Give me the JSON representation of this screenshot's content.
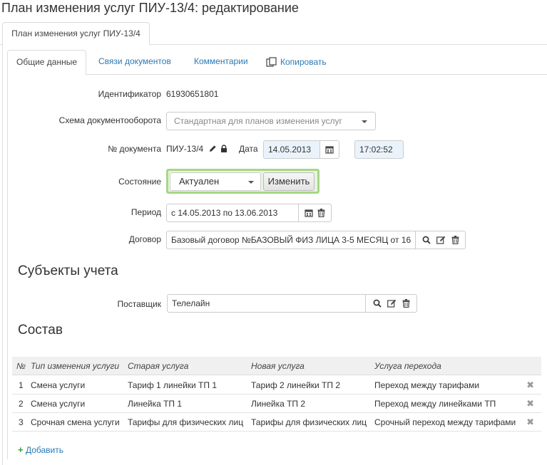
{
  "page": {
    "title": "План изменения услуг ПИУ-13/4: редактирование"
  },
  "outer_tabs": [
    {
      "label": "План изменения услуг ПИУ-13/4"
    }
  ],
  "inner_tabs": {
    "general": "Общие данные",
    "links": "Связи документов",
    "comments": "Комментарии",
    "copy": "Копировать"
  },
  "form": {
    "identifier_label": "Идентификатор",
    "identifier_value": "61930651801",
    "workflow_label": "Схема документооборота",
    "workflow_value": "Стандартная для планов изменения услуг",
    "docnum_label": "№ документа",
    "docnum_value": "ПИУ-13/4",
    "date_label": "Дата",
    "date_value": "14.05.2013",
    "time_value": "17:02:52",
    "state_label": "Состояние",
    "state_value": "Актуален",
    "state_button": "Изменить",
    "period_label": "Период",
    "period_value": "с 14.05.2013 по 13.06.2013",
    "contract_label": "Договор",
    "contract_value": "Базовый договор №БАЗОВЫЙ ФИЗ ЛИЦА 3-5 МЕСЯЦ от 16"
  },
  "subjects": {
    "title": "Субъекты учета",
    "provider_label": "Поставщик",
    "provider_value": "Телелайн"
  },
  "composition": {
    "title": "Состав",
    "columns": [
      "№",
      "Тип изменения услуги",
      "Старая услуга",
      "Новая услуга",
      "Услуга перехода"
    ],
    "rows": [
      {
        "n": "1",
        "type": "Смена услуги",
        "old": "Тариф 1 линейки ТП 1",
        "new": "Тариф 2 линейки ТП 2",
        "transition": "Переход между тарифами"
      },
      {
        "n": "2",
        "type": "Смена услуги",
        "old": "Линейка ТП 1",
        "new": "Линейка ТП 2",
        "transition": "Переход между линейками ТП"
      },
      {
        "n": "3",
        "type": "Срочная смена услуги",
        "old": "Тарифы для физических лиц",
        "new": "Тарифы для физических лиц",
        "transition": "Срочный переход между тарифами"
      }
    ],
    "add_label": "Добавить"
  },
  "colors": {
    "link": "#2a7ab6",
    "state_border": "#a6d785",
    "date_bg": "#eaf3fb",
    "add_plus": "#3aa33a"
  }
}
